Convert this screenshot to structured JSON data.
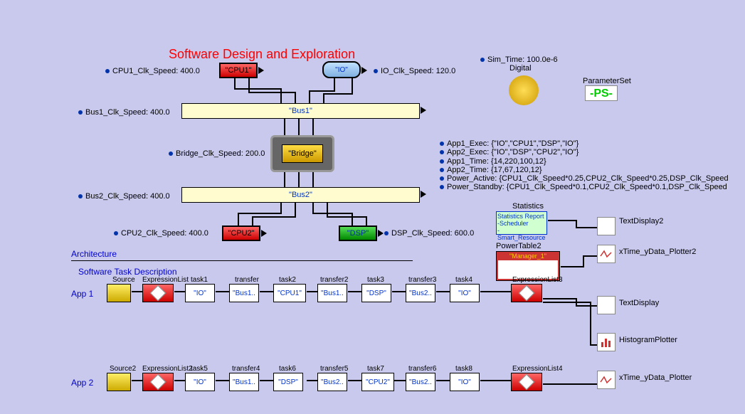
{
  "title": "Software Design and Exploration",
  "sections": {
    "architecture": "Architecture",
    "software_task": "Software Task Description"
  },
  "top_params": {
    "cpu1": "CPU1_Clk_Speed: 400.0",
    "io": "IO_Clk_Speed: 120.0",
    "bus1": "Bus1_Clk_Speed: 400.0",
    "bridge": "Bridge_Clk_Speed: 200.0",
    "bus2": "Bus2_Clk_Speed: 400.0",
    "cpu2": "CPU2_Clk_Speed: 400.0",
    "dsp": "DSP_Clk_Speed: 600.0",
    "sim_time": "Sim_Time: 100.0e-6"
  },
  "blocks": {
    "cpu1": "\"CPU1\"",
    "io": "\"IO\"",
    "bus1": "\"Bus1\"",
    "bridge": "\"Bridge\"",
    "bus2": "\"Bus2\"",
    "cpu2": "\"CPU2\"",
    "dsp": "\"DSP\""
  },
  "right_params": {
    "digital": "Digital",
    "paramset": "ParameterSet",
    "ps": "-PS-",
    "app1_exec": "App1_Exec: {\"IO\",\"CPU1\",\"DSP\",\"IO\"}",
    "app2_exec": "App2_Exec: {\"IO\",\"DSP\",\"CPU2\",\"IO\"}",
    "app1_time": "App1_Time: {14,220,100,12}",
    "app2_time": "App2_Time: {17,67,120,12}",
    "power_active": "Power_Active: {CPU1_Clk_Speed*0.25,CPU2_Clk_Speed*0.25,DSP_Clk_Speed",
    "power_standby": "Power_Standby: {CPU1_Clk_Speed*0.1,CPU2_Clk_Speed*0.1,DSP_Clk_Speed"
  },
  "stats": {
    "title": "Statistics",
    "lines": [
      "Statistics Report",
      "-Scheduler",
      "-Smart_Resource"
    ]
  },
  "power_table": {
    "title": "PowerTable2",
    "inner": "\"Manager_1\""
  },
  "displays": {
    "text2": "TextDisplay2",
    "xy2": "xTime_yData_Plotter2",
    "text": "TextDisplay",
    "hist": "HistogramPlotter",
    "xy": "xTime_yData_Plotter"
  },
  "app1": {
    "label": "App 1",
    "source": "Source",
    "exprlist": "ExpressionList",
    "exprlist3": "ExpressionList3",
    "t1": "task1",
    "t1v": "\"IO\"",
    "tr1": "transfer",
    "tr1v": "\"Bus1..",
    "t2": "task2",
    "t2v": "\"CPU1\"",
    "tr2": "transfer2",
    "tr2v": "\"Bus1..",
    "t3": "task3",
    "t3v": "\"DSP\"",
    "tr3": "transfer3",
    "tr3v": "\"Bus2..",
    "t4": "task4",
    "t4v": "\"IO\""
  },
  "app2": {
    "label": "App 2",
    "source": "Source2",
    "exprlist": "ExpressionList2",
    "exprlist4": "ExpressionList4",
    "t5": "task5",
    "t5v": "\"IO\"",
    "tr4": "transfer4",
    "tr4v": "\"Bus1..",
    "t6": "task6",
    "t6v": "\"DSP\"",
    "tr5": "transfer5",
    "tr5v": "\"Bus2..",
    "t7": "task7",
    "t7v": "\"CPU2\"",
    "tr6": "transfer6",
    "tr6v": "\"Bus2..",
    "t8": "task8",
    "t8v": "\"IO\""
  }
}
